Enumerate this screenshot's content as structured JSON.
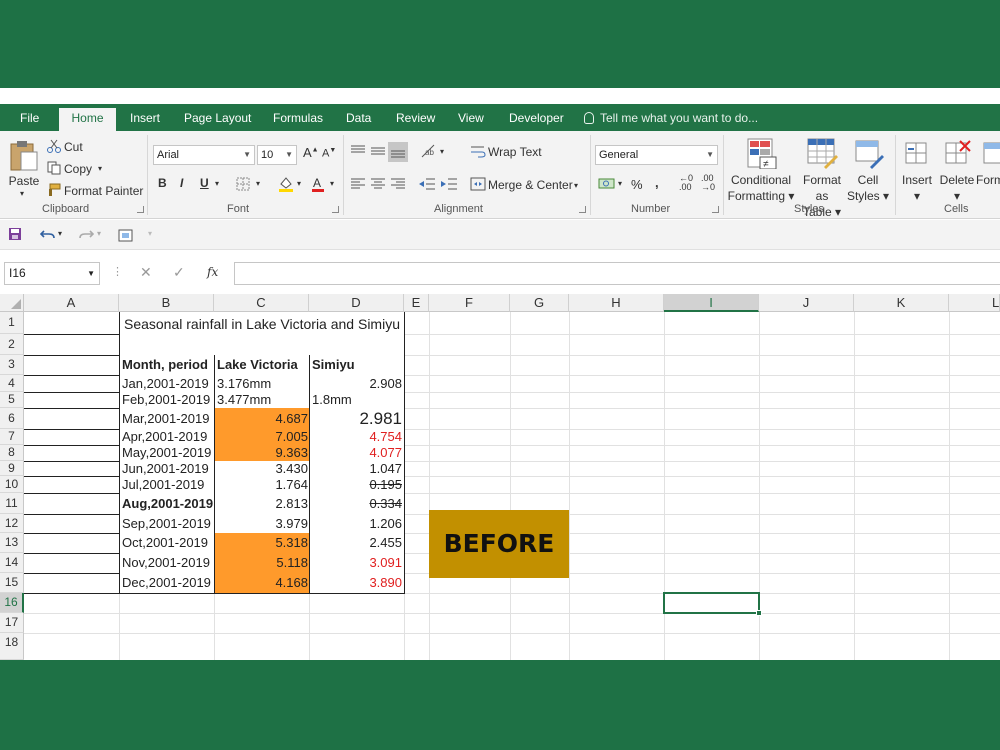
{
  "tabs": [
    "File",
    "Home",
    "Insert",
    "Page Layout",
    "Formulas",
    "Data",
    "Review",
    "View",
    "Developer"
  ],
  "active_tab": "Home",
  "tell_me": "Tell me what you want to do...",
  "clipboard": {
    "paste": "Paste",
    "cut": "Cut",
    "copy": "Copy",
    "format_painter": "Format Painter",
    "label": "Clipboard"
  },
  "font": {
    "name": "Arial",
    "size": "10",
    "bold": "B",
    "italic": "I",
    "underline": "U",
    "label": "Font"
  },
  "alignment": {
    "wrap_text": "Wrap Text",
    "merge_center": "Merge & Center",
    "label": "Alignment"
  },
  "number": {
    "format": "General",
    "percent": "%",
    "comma": ",",
    "label": "Number"
  },
  "styles": {
    "conditional_1": "Conditional",
    "conditional_2": "Formatting",
    "format_table_1": "Format as",
    "format_table_2": "Table",
    "cell_styles_1": "Cell",
    "cell_styles_2": "Styles",
    "label": "Styles"
  },
  "cells": {
    "insert": "Insert",
    "delete": "Delete",
    "format": "Form",
    "label": "Cells"
  },
  "formula_bar": {
    "name_box": "I16",
    "fx": "fx",
    "content": ""
  },
  "columns": [
    "A",
    "B",
    "C",
    "D",
    "E",
    "F",
    "G",
    "H",
    "I",
    "J",
    "K",
    "L"
  ],
  "rows": [
    "1",
    "2",
    "3",
    "4",
    "5",
    "6",
    "7",
    "8",
    "9",
    "10",
    "11",
    "12",
    "13",
    "14",
    "15",
    "16",
    "17",
    "18"
  ],
  "sheet": {
    "title": "Seasonal rainfall in Lake Victoria and Simiyu",
    "headers": [
      "Month, period",
      "Lake Victoria",
      "Simiyu"
    ],
    "data": [
      {
        "month": "Jan,2001-2019",
        "lake": "3.176mm",
        "simiyu": "2.908",
        "lake_style": "left",
        "simiyu_style": ""
      },
      {
        "month": "Feb,2001-2019",
        "lake": "3.477mm",
        "simiyu": "1.8mm",
        "lake_style": "left",
        "simiyu_style": "left"
      },
      {
        "month": "Mar,2001-2019",
        "lake": "4.687",
        "simiyu": "2.981",
        "lake_style": "orange",
        "simiyu_style": "big"
      },
      {
        "month": "Apr,2001-2019",
        "lake": "7.005",
        "simiyu": "4.754",
        "lake_style": "orange",
        "simiyu_style": "red"
      },
      {
        "month": "May,2001-2019",
        "lake": "9.363",
        "simiyu": "4.077",
        "lake_style": "orange",
        "simiyu_style": "red"
      },
      {
        "month": "Jun,2001-2019",
        "lake": "3.430",
        "simiyu": "1.047",
        "lake_style": "",
        "simiyu_style": ""
      },
      {
        "month": "Jul,2001-2019",
        "lake": "1.764",
        "simiyu": "0.195",
        "lake_style": "",
        "simiyu_style": "strike"
      },
      {
        "month": "Aug,2001-2019",
        "lake": "2.813",
        "simiyu": "0.334",
        "lake_style": "",
        "simiyu_style": "strike",
        "month_bold": true
      },
      {
        "month": "Sep,2001-2019",
        "lake": "3.979",
        "simiyu": "1.206",
        "lake_style": "",
        "simiyu_style": ""
      },
      {
        "month": "Oct,2001-2019",
        "lake": "5.318",
        "simiyu": "2.455",
        "lake_style": "orange",
        "simiyu_style": ""
      },
      {
        "month": "Nov,2001-2019",
        "lake": "5.118",
        "simiyu": "3.091",
        "lake_style": "orange",
        "simiyu_style": "red"
      },
      {
        "month": "Dec,2001-2019",
        "lake": "4.168",
        "simiyu": "3.890",
        "lake_style": "orange",
        "simiyu_style": "red"
      }
    ],
    "badge": "BEFORE"
  },
  "colors": {
    "excel_green": "#217346",
    "band_green": "#1e7145",
    "highlight_orange": "#ff9a2b",
    "badge_gold": "#c29000",
    "negative_red": "#e02020"
  }
}
